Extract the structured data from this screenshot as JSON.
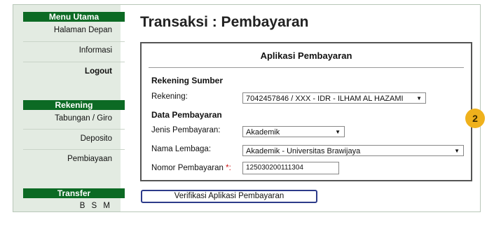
{
  "sidebar": {
    "menu_utama": {
      "header": "Menu Utama",
      "items": [
        "Halaman Depan",
        "Informasi",
        "Logout"
      ]
    },
    "rekening": {
      "header": "Rekening",
      "items": [
        "Tabungan / Giro",
        "Deposito",
        "Pembiayaan"
      ]
    },
    "transfer": {
      "header": "Transfer",
      "items": [
        "B S M"
      ]
    }
  },
  "page": {
    "title": "Transaksi : Pembayaran"
  },
  "form": {
    "title": "Aplikasi Pembayaran",
    "sumber_label": "Rekening Sumber",
    "rekening_label": "Rekening:",
    "rekening_value": "7042457846 / XXX - IDR - ILHAM AL HAZAMI",
    "data_label": "Data Pembayaran",
    "jenis_label": "Jenis Pembayaran:",
    "jenis_value": "Akademik",
    "lembaga_label": "Nama Lembaga:",
    "lembaga_value": "Akademik - Universitas Brawijaya",
    "nomor_label": "Nomor Pembayaran",
    "nomor_required": "*:",
    "nomor_value": "125030200111304"
  },
  "actions": {
    "verify": "Verifikasi Aplikasi Pembayaran"
  },
  "badge": {
    "number": "2"
  },
  "colors": {
    "sidebar_header": "#0c6a24",
    "badge": "#efb11c",
    "button_border": "#2d3b8a"
  }
}
